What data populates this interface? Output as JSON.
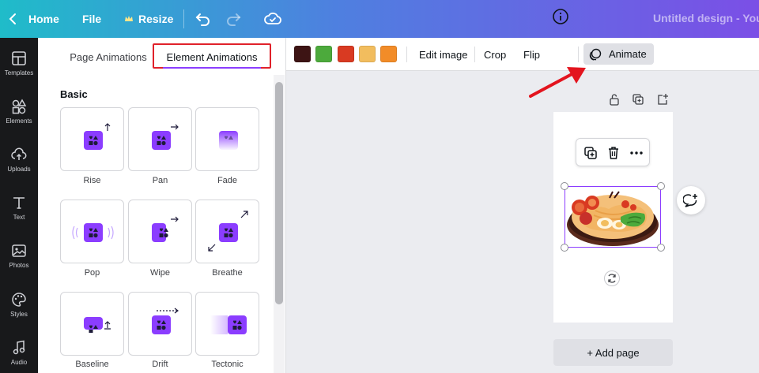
{
  "topbar": {
    "home_label": "Home",
    "file_label": "File",
    "resize_label": "Resize",
    "title": "Untitled design - Your S"
  },
  "rail": {
    "items": [
      {
        "label": "Templates",
        "icon": "templates-icon"
      },
      {
        "label": "Elements",
        "icon": "elements-icon"
      },
      {
        "label": "Uploads",
        "icon": "upload-icon"
      },
      {
        "label": "Text",
        "icon": "text-icon"
      },
      {
        "label": "Photos",
        "icon": "photos-icon"
      },
      {
        "label": "Styles",
        "icon": "palette-icon"
      },
      {
        "label": "Audio",
        "icon": "music-icon"
      }
    ]
  },
  "panel": {
    "tabs": [
      {
        "label": "Page Animations"
      },
      {
        "label": "Element Animations"
      }
    ],
    "section_title": "Basic",
    "animations": [
      {
        "label": "Rise"
      },
      {
        "label": "Pan"
      },
      {
        "label": "Fade"
      },
      {
        "label": "Pop"
      },
      {
        "label": "Wipe"
      },
      {
        "label": "Breathe"
      },
      {
        "label": "Baseline"
      },
      {
        "label": "Drift"
      },
      {
        "label": "Tectonic"
      }
    ]
  },
  "toolbar": {
    "colors": [
      "#3d1414",
      "#4caa3c",
      "#d93a22",
      "#f2bd5e",
      "#f28c28"
    ],
    "edit_image_label": "Edit image",
    "crop_label": "Crop",
    "flip_label": "Flip",
    "animate_label": "Animate"
  },
  "canvas": {
    "add_page_label": "+ Add page"
  },
  "colors": {
    "accent": "#8b3dff",
    "highlight_box": "#e0212a",
    "arrow": "#e3141e"
  }
}
